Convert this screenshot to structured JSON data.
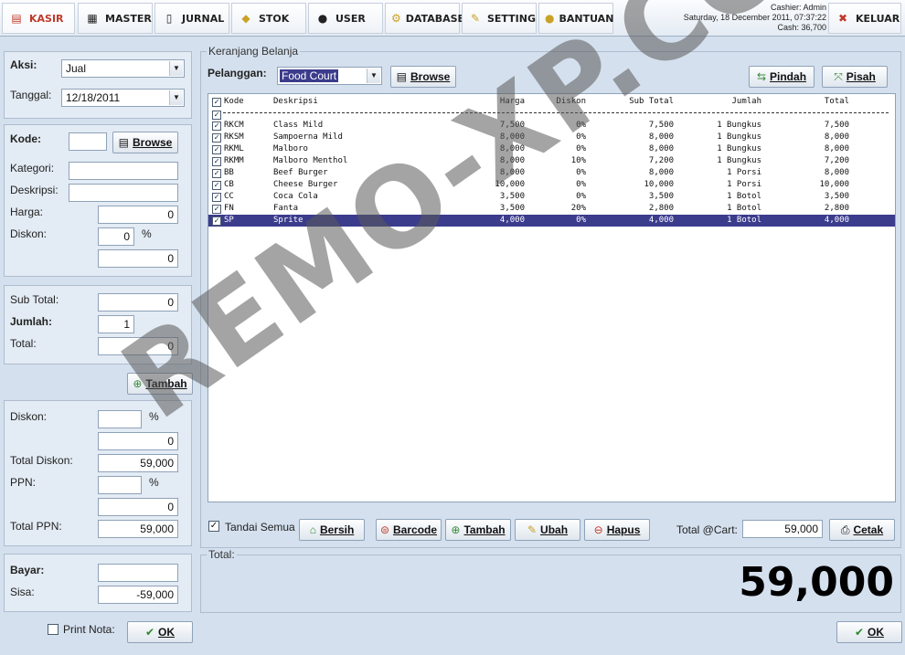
{
  "nav": [
    {
      "label": "KASIR",
      "icon": "cashier-icon"
    },
    {
      "label": "MASTER",
      "icon": "master-icon"
    },
    {
      "label": "JURNAL",
      "icon": "journal-icon"
    },
    {
      "label": "STOK",
      "icon": "stock-icon"
    },
    {
      "label": "USER",
      "icon": "user-icon"
    },
    {
      "label": "DATABASE",
      "icon": "database-icon"
    },
    {
      "label": "SETTING",
      "icon": "setting-icon"
    },
    {
      "label": "BANTUAN",
      "icon": "help-icon"
    }
  ],
  "userinfo": {
    "cashier": "Cashier: Admin",
    "datetime": "Saturday, 18 December 2011, 07:37:22",
    "cash": "Cash: 36,700"
  },
  "logout_label": "KELUAR",
  "left": {
    "aksi_label": "Aksi:",
    "aksi_value": "Jual",
    "tanggal_label": "Tanggal:",
    "tanggal_value": "12/18/2011",
    "kode_label": "Kode:",
    "kode_value": "",
    "browse_label": "Browse",
    "kategori_label": "Kategori:",
    "kategori_value": "",
    "deskripsi_label": "Deskripsi:",
    "deskripsi_value": "",
    "harga_label": "Harga:",
    "harga_value": "0",
    "diskon_label": "Diskon:",
    "diskon_pct": "0",
    "diskon_pct_sign": "%",
    "diskon_value": "0",
    "subtotal_label": "Sub Total:",
    "subtotal_value": "0",
    "jumlah_label": "Jumlah:",
    "jumlah_value": "1",
    "total_label": "Total:",
    "total_value": "0",
    "tambah_label": "Tambah",
    "diskon2_label": "Diskon:",
    "diskon2_pct": "",
    "diskon2_pct_sign": "%",
    "diskon2_value": "0",
    "total_diskon_label": "Total Diskon:",
    "total_diskon_value": "59,000",
    "ppn_label": "PPN:",
    "ppn_pct": "",
    "ppn_pct_sign": "%",
    "ppn_value": "0",
    "total_ppn_label": "Total PPN:",
    "total_ppn_value": "59,000",
    "bayar_label": "Bayar:",
    "bayar_value": "",
    "sisa_label": "Sisa:",
    "sisa_value": "-59,000",
    "print_nota_label": "Print Nota:",
    "ok_label": "OK"
  },
  "cart": {
    "legend": "Keranjang Belanja",
    "pelanggan_label": "Pelanggan:",
    "pelanggan_value": "Food Court",
    "browse_label": "Browse",
    "pindah_label": "Pindah",
    "pisah_label": "Pisah",
    "columns": [
      "Kode",
      "Deskripsi",
      "Harga",
      "Diskon",
      "Sub Total",
      "Jumlah",
      "Total"
    ],
    "rows": [
      {
        "kode": "RKCM",
        "desk": "Class Mild",
        "harga": "7,500",
        "diskon": "0%",
        "subtotal": "7,500",
        "jumlah": "1 Bungkus",
        "total": "7,500"
      },
      {
        "kode": "RKSM",
        "desk": "Sampoerna Mild",
        "harga": "8,000",
        "diskon": "0%",
        "subtotal": "8,000",
        "jumlah": "1 Bungkus",
        "total": "8,000"
      },
      {
        "kode": "RKML",
        "desk": "Malboro",
        "harga": "8,000",
        "diskon": "0%",
        "subtotal": "8,000",
        "jumlah": "1 Bungkus",
        "total": "8,000"
      },
      {
        "kode": "RKMM",
        "desk": "Malboro Menthol",
        "harga": "8,000",
        "diskon": "10%",
        "subtotal": "7,200",
        "jumlah": "1 Bungkus",
        "total": "7,200"
      },
      {
        "kode": "BB",
        "desk": "Beef Burger",
        "harga": "8,000",
        "diskon": "0%",
        "subtotal": "8,000",
        "jumlah": "1 Porsi",
        "total": "8,000"
      },
      {
        "kode": "CB",
        "desk": "Cheese Burger",
        "harga": "10,000",
        "diskon": "0%",
        "subtotal": "10,000",
        "jumlah": "1 Porsi",
        "total": "10,000"
      },
      {
        "kode": "CC",
        "desk": "Coca Cola",
        "harga": "3,500",
        "diskon": "0%",
        "subtotal": "3,500",
        "jumlah": "1 Botol",
        "total": "3,500"
      },
      {
        "kode": "FN",
        "desk": "Fanta",
        "harga": "3,500",
        "diskon": "20%",
        "subtotal": "2,800",
        "jumlah": "1 Botol",
        "total": "2,800"
      },
      {
        "kode": "SP",
        "desk": "Sprite",
        "harga": "4,000",
        "diskon": "0%",
        "subtotal": "4,000",
        "jumlah": "1 Botol",
        "total": "4,000"
      }
    ],
    "tandai_label": "Tandai Semua",
    "bersih_label": "Bersih",
    "barcode_label": "Barcode",
    "tambah_label": "Tambah",
    "ubah_label": "Ubah",
    "hapus_label": "Hapus",
    "total_cart_label": "Total @Cart:",
    "total_cart_value": "59,000",
    "cetak_label": "Cetak"
  },
  "total": {
    "legend": "Total:",
    "value": "59,000"
  },
  "ok_label": "OK",
  "watermark": "REMO-XP.COM"
}
